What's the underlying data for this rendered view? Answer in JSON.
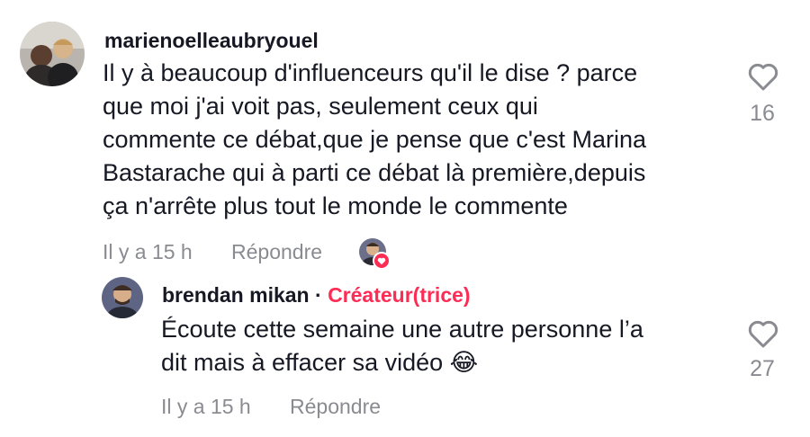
{
  "comments": [
    {
      "username": "marienoelleaubryouel",
      "lines": [
        "Il y à beaucoup d'influenceurs qu'il le dise ? parce",
        "que moi j'ai voit pas, seulement ceux qui",
        "commente ce débat,que je pense que c'est Marina",
        "Bastarache qui à parti ce débat là première,depuis",
        "ça n'arrête plus tout le monde le commente"
      ],
      "time": "Il y a 15 h",
      "reply_label": "Répondre",
      "like_count": "16"
    }
  ],
  "reply": {
    "username": "brendan mikan",
    "separator": "·",
    "creator_label": "Créateur(trice)",
    "lines": [
      "Écoute cette semaine une autre personne l’a",
      "dit mais à effacer sa vidéo 😂"
    ],
    "time": "Il y a 15 h",
    "reply_label": "Répondre",
    "like_count": "27"
  },
  "colors": {
    "accent": "#fe2c55",
    "muted": "#8a8b91",
    "text": "#161823"
  },
  "icons": {
    "like": "heart-outline-icon",
    "creator_liked": "heart-badge-icon"
  }
}
